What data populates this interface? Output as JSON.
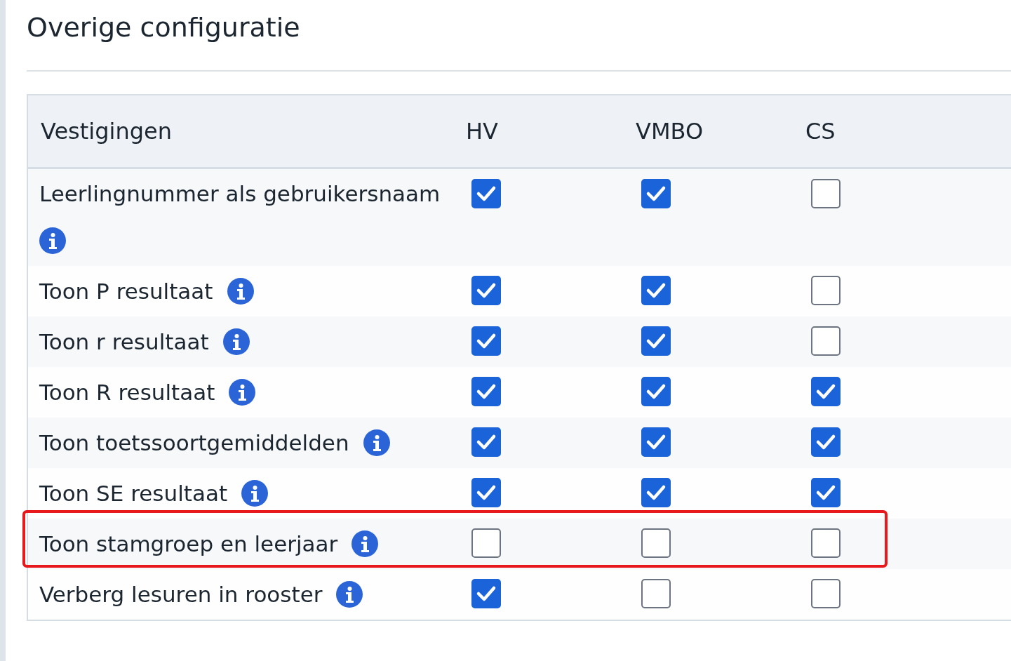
{
  "title": "Overige configuratie",
  "table": {
    "columns": [
      "Vestigingen",
      "HV",
      "VMBO",
      "CS"
    ],
    "rows": [
      {
        "label": "Leerlingnummer als gebruikersnaam",
        "checks": [
          true,
          true,
          false
        ],
        "highlighted": false
      },
      {
        "label": "Toon P resultaat",
        "checks": [
          true,
          true,
          false
        ],
        "highlighted": false
      },
      {
        "label": "Toon r resultaat",
        "checks": [
          true,
          true,
          false
        ],
        "highlighted": false
      },
      {
        "label": "Toon R resultaat",
        "checks": [
          true,
          true,
          true
        ],
        "highlighted": false
      },
      {
        "label": "Toon toetssoortgemiddelden",
        "checks": [
          true,
          true,
          true
        ],
        "highlighted": false
      },
      {
        "label": "Toon SE resultaat",
        "checks": [
          true,
          true,
          true
        ],
        "highlighted": false
      },
      {
        "label": "Toon stamgroep en leerjaar",
        "checks": [
          false,
          false,
          false
        ],
        "highlighted": true
      },
      {
        "label": "Verberg lesuren in rooster",
        "checks": [
          true,
          false,
          false
        ],
        "highlighted": false
      }
    ]
  }
}
